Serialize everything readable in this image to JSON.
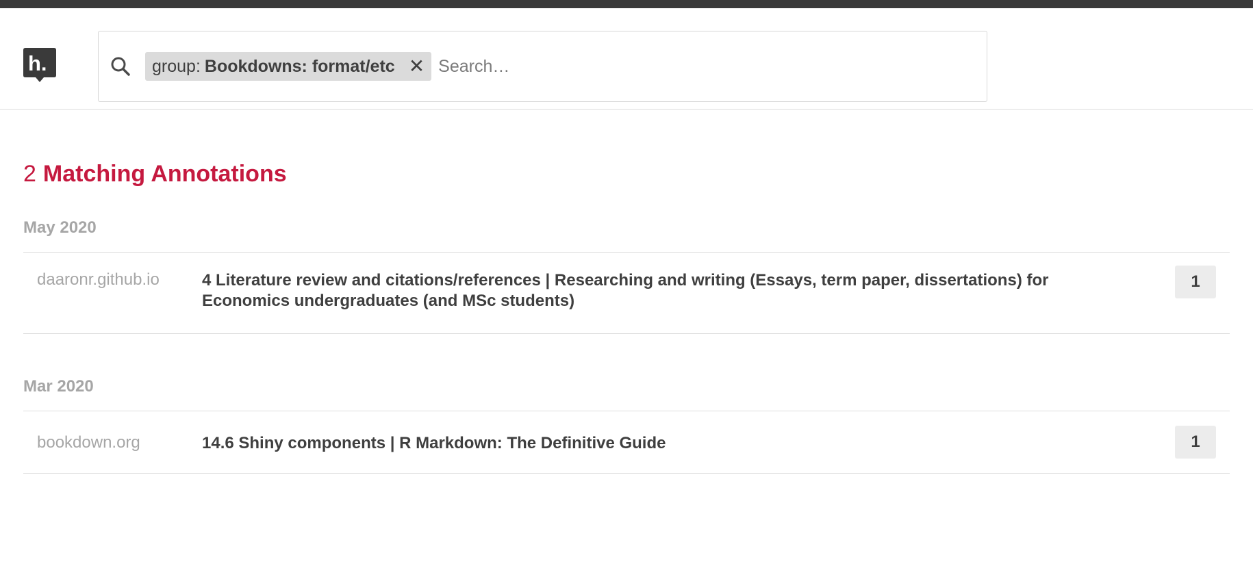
{
  "header": {
    "logo_text": "h.",
    "search": {
      "chip": {
        "key": "group:",
        "value": "Bookdowns: format/etc",
        "remove_glyph": "✕"
      },
      "placeholder": "Search…",
      "value": ""
    }
  },
  "results": {
    "count": "2",
    "label": "Matching Annotations",
    "groups": [
      {
        "heading": "May 2020",
        "items": [
          {
            "domain": "daaronr.github.io",
            "title": "4 Literature review and citations/references | Researching and writing (Essays, term paper, dissertations) for Economics undergraduates (and MSc students)",
            "count": "1"
          }
        ]
      },
      {
        "heading": "Mar 2020",
        "items": [
          {
            "domain": "bookdown.org",
            "title": "14.6 Shiny components | R Markdown: The Definitive Guide",
            "count": "1"
          }
        ]
      }
    ]
  },
  "colors": {
    "accent": "#c5193f",
    "logo": "#3a3a3a",
    "muted": "#a6a6a6",
    "text": "#3f3f3f"
  },
  "icons": [
    "hypothesis-logo-icon",
    "search-icon",
    "close-icon"
  ]
}
